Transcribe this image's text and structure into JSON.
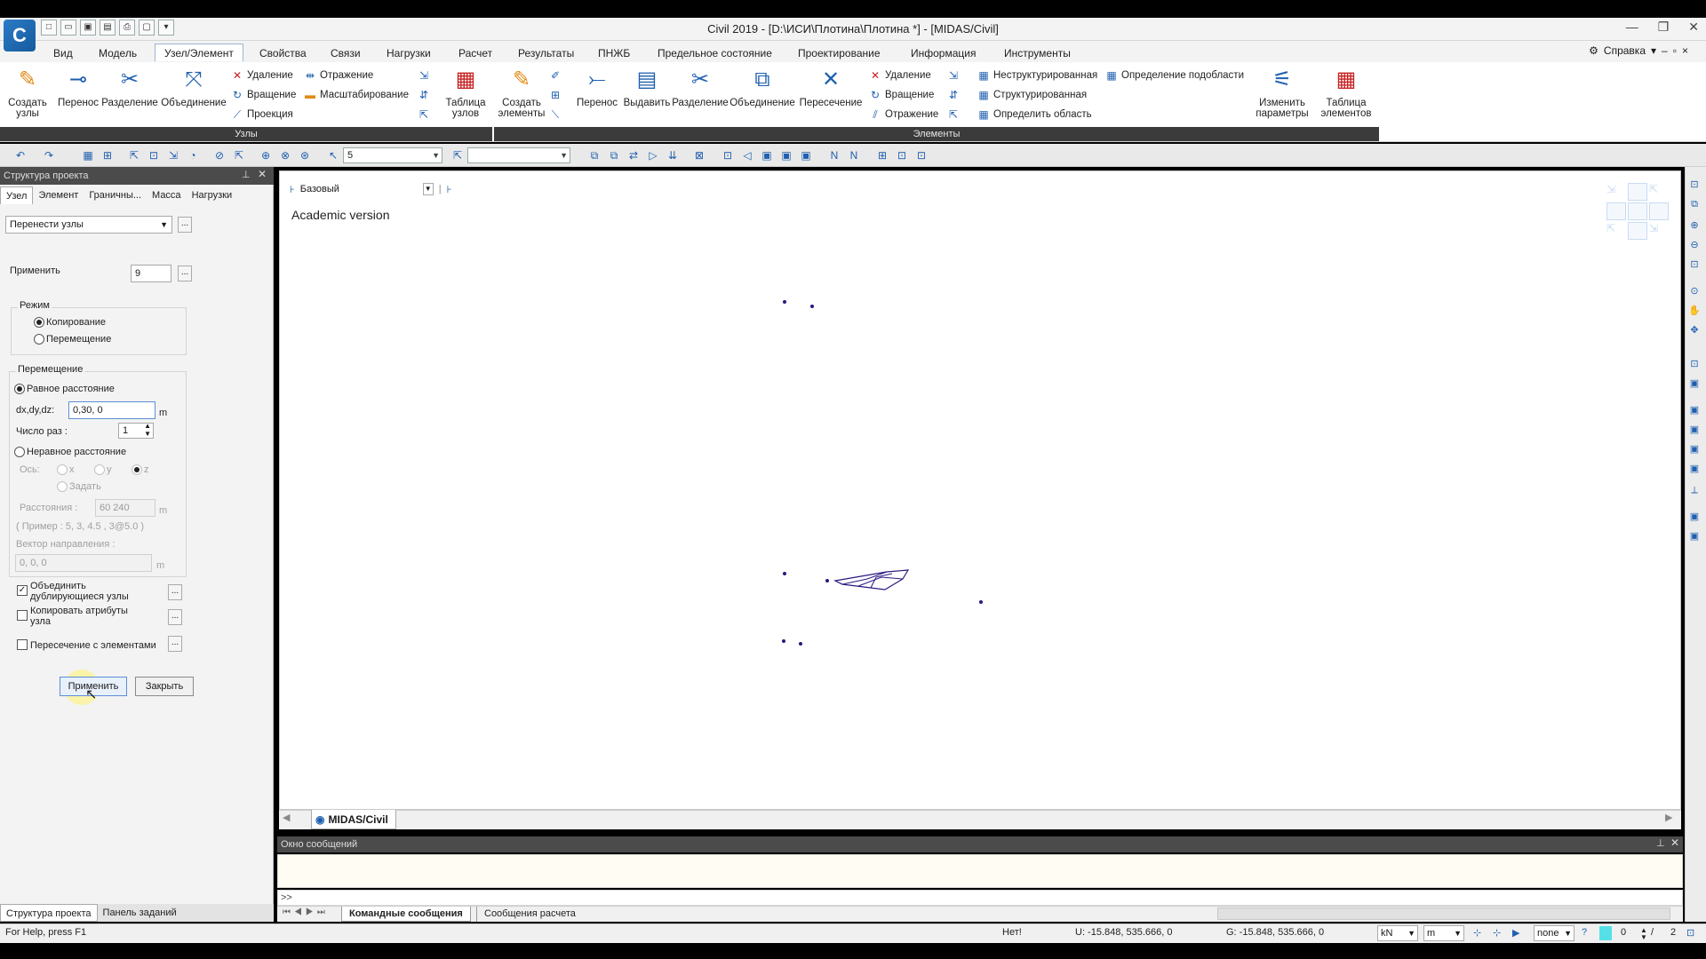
{
  "window": {
    "title": "Civil 2019 - [D:\\ИСИ\\Плотина\\Плотина *] - [MIDAS/Civil]",
    "logo_letter": "C",
    "controls": [
      "—",
      "❐",
      "✕"
    ]
  },
  "menu": {
    "tabs": [
      "Вид",
      "Модель",
      "Узел/Элемент",
      "Свойства",
      "Связи",
      "Нагрузки",
      "Расчет",
      "Результаты",
      "ПНЖБ",
      "Предельное состояние",
      "Проектирование",
      "Информация",
      "Инструменты"
    ],
    "active_index": 2,
    "help_label": "Справка"
  },
  "ribbon": {
    "nodes_group_label": "Узлы",
    "elements_group_label": "Элементы",
    "create_nodes": "Создать узлы",
    "move": "Перенос",
    "split": "Разделение",
    "merge": "Объединение",
    "delete": "Удаление",
    "rotate": "Вращение",
    "projection": "Проекция",
    "mirror": "Отражение",
    "scale": "Масштабирование",
    "node_table": "Таблица узлов",
    "create_elements": "Создать элементы",
    "el_move": "Перенос",
    "extrude": "Выдавить",
    "el_split": "Разделение",
    "el_merge": "Объединение",
    "intersect": "Пересечение",
    "el_delete": "Удаление",
    "el_rotate": "Вращение",
    "el_mirror": "Отражение",
    "unstructured": "Неструктурированная",
    "structured": "Структурированная",
    "define_area": "Определить область",
    "define_subarea": "Определение подобласти",
    "change_params": "Изменить параметры",
    "element_table": "Таблица элементов"
  },
  "toolbar": {
    "combo_value": "5"
  },
  "left_panel": {
    "header": "Структура проекта",
    "tabs": [
      "Узел",
      "Элемент",
      "Граничны...",
      "Масса",
      "Нагрузки"
    ],
    "function_select": "Перенести узлы",
    "apply_label": "Применить",
    "apply_value": "9",
    "mode_label": "Режим",
    "mode_copy": "Копирование",
    "mode_move": "Перемещение",
    "translation_label": "Перемещение",
    "equal_distance": "Равное расстояние",
    "dxdydz_label": "dx,dy,dz:",
    "dxdydz_value": "0,30, 0",
    "unit_m": "m",
    "times_label": "Число раз :",
    "times_value": "1",
    "unequal_distance": "Неравное расстояние",
    "axis_label": "Ось:",
    "axis_x": "x",
    "axis_y": "y",
    "axis_z": "z",
    "axis_define": "Задать",
    "distances_label": "Расстояния :",
    "distances_value": "60 240",
    "example_text": "( Пример :  5, 3, 4.5 , 3@5.0 )",
    "direction_label": "Вектор направления :",
    "direction_value": "0, 0, 0",
    "merge_dup": "Объединить дублирующиеся узлы",
    "copy_attrs": "Копировать атрибуты узла",
    "intersect_elems": "Пересечение с элементами",
    "btn_apply": "Применить",
    "btn_close": "Закрыть",
    "bottom_tabs": [
      "Структура проекта",
      "Панель заданий"
    ]
  },
  "viewport": {
    "view_name": "Базовый",
    "watermark": "Academic version",
    "tab_label": "MIDAS/Civil"
  },
  "messages": {
    "header": "Окно сообщений",
    "prompt": ">>",
    "tabs": [
      "Командные сообщения",
      "Сообщения расчета"
    ]
  },
  "status": {
    "help": "For Help, press F1",
    "snap": "Нет!",
    "ucs_coords": "U: -15.848, 535.666, 0",
    "global_coords": "G: -15.848, 535.666, 0",
    "force_unit": "kN",
    "length_unit": "m",
    "mode": "none",
    "counter_left": "0",
    "counter_right": "2"
  },
  "colors": {
    "accent": "#1f5fb0",
    "node": "#2a1780",
    "group_label_bg": "#3b3b3b"
  }
}
